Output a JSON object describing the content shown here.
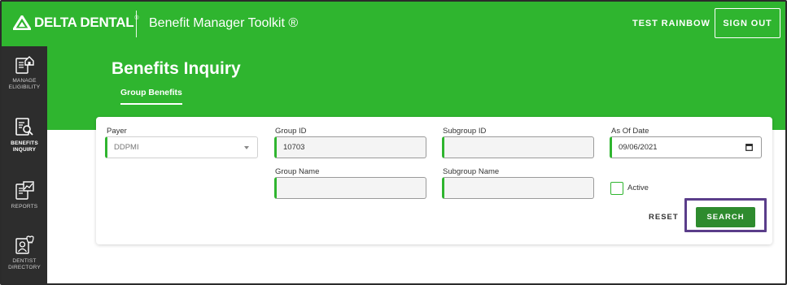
{
  "header": {
    "logo_text": "DELTA DENTAL",
    "logo_mark": "®",
    "app_title": "Benefit Manager Toolkit ®",
    "user_name": "TEST RAINBOW",
    "signout_label": "SIGN OUT"
  },
  "sidebar": {
    "items": [
      {
        "label": "MANAGE\nELIGIBILITY",
        "icon": "document-home-icon",
        "active": false
      },
      {
        "label": "BENEFITS\nINQUIRY",
        "icon": "document-search-icon",
        "active": true
      },
      {
        "label": "REPORTS",
        "icon": "document-chart-icon",
        "active": false
      },
      {
        "label": "DENTIST\nDIRECTORY",
        "icon": "dentist-profile-icon",
        "active": false
      }
    ]
  },
  "page": {
    "title": "Benefits Inquiry",
    "tab_label": "Group Benefits"
  },
  "form": {
    "payer_label": "Payer",
    "payer_value": "DDPMI",
    "group_id_label": "Group ID",
    "group_id_value": "10703",
    "subgroup_id_label": "Subgroup ID",
    "subgroup_id_value": "",
    "as_of_date_label": "As Of Date",
    "as_of_date_value": "09/06/2021",
    "group_name_label": "Group Name",
    "group_name_value": "",
    "subgroup_name_label": "Subgroup Name",
    "subgroup_name_value": "",
    "active_label": "Active",
    "active_checked": false,
    "reset_label": "RESET",
    "search_label": "SEARCH"
  },
  "colors": {
    "brand_green": "#2fb52f",
    "button_green": "#2e8b2e",
    "sidebar_bg": "#2d2d2d",
    "highlight_purple": "#5a3d8a"
  }
}
